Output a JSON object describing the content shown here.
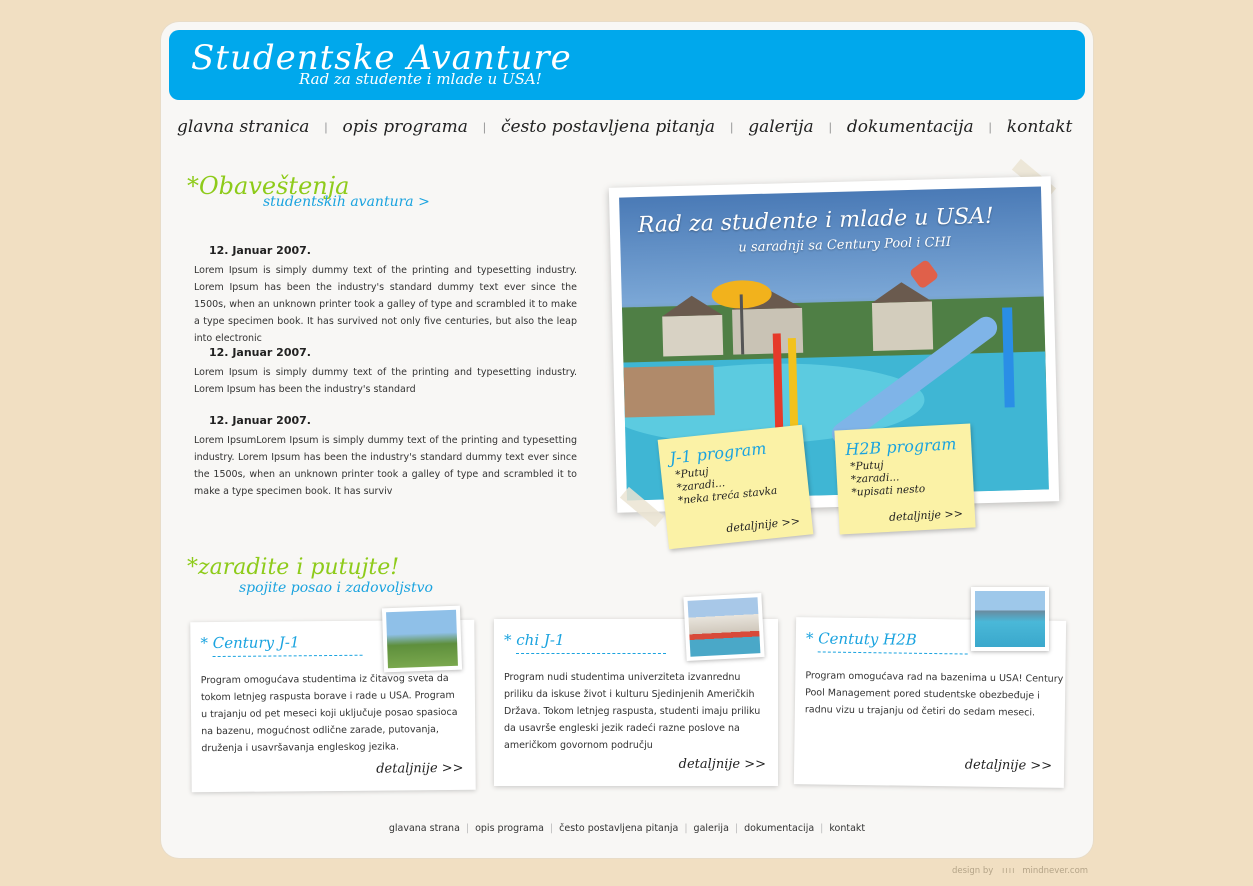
{
  "site": {
    "title": "Studentske Avanture",
    "tagline": "Rad za studente i mlade u USA!"
  },
  "nav": {
    "items": [
      "glavna stranica",
      "opis programa",
      "često postavljena pitanja",
      "galerija",
      "dokumentacija",
      "kontakt"
    ]
  },
  "news_section": {
    "title": "*Obaveštenja",
    "subtitle": "studentskih avantura >",
    "items": [
      {
        "date": "12. Januar 2007.",
        "text": "Lorem Ipsum is simply dummy text of the printing and typesetting industry. Lorem Ipsum has been the industry's standard dummy text ever since the 1500s, when an unknown printer took a galley of type and scrambled it to make a type specimen book. It has survived not only five centuries, but also the leap into electronic"
      },
      {
        "date": "12. Januar 2007.",
        "text": "Lorem Ipsum is simply dummy text of the printing and typesetting industry. Lorem Ipsum has been the industry's standard"
      },
      {
        "date": "12. Januar 2007.",
        "text": "Lorem IpsumLorem Ipsum is simply dummy text of the printing and typesetting industry. Lorem Ipsum has been the industry's standard dummy text ever since the 1500s, when an unknown printer took a galley of type and scrambled it to make a type specimen book. It has surviv"
      }
    ]
  },
  "hero": {
    "headline": "Rad za studente i mlade u USA!",
    "subline": "u saradnji sa Century Pool i CHI",
    "notes": [
      {
        "title": "J-1 program",
        "bullets": [
          "*Putuj",
          "*zaradi...",
          "*neka treća stavka"
        ],
        "more": "detaljnije >>"
      },
      {
        "title": "H2B program",
        "bullets": [
          "*Putuj",
          "*zaradi...",
          "*upisati nesto"
        ],
        "more": "detaljnije >>"
      }
    ]
  },
  "earn_section": {
    "title": "*zaradite i putujte!",
    "subtitle": "spojite posao i zadovoljstvo"
  },
  "cards": [
    {
      "title": "* Century J-1",
      "text": "Program omogućava studentima iz čitavog sveta da tokom letnjeg raspusta borave i rade u USA. Program u trajanju od pet meseci koji uključuje posao spasioca na bazenu, mogućnost odlične zarade, putovanja, druženja i usavršavanja engleskog jezika.",
      "more": "detaljnije >>"
    },
    {
      "title": "* chi J-1",
      "text": "Program nudi studentima univerziteta izvanrednu priliku da iskuse život i kulturu Sjedinjenih Američkih Država. Tokom letnjeg raspusta, studenti imaju priliku da usavrše engleski jezik radeći razne poslove na američkom govornom području",
      "more": "detaljnije >>"
    },
    {
      "title": "* Centuty H2B",
      "text": "Program omogućava rad na bazenima u USA! Century Pool Management pored studentske obezbeđuje i radnu vizu u trajanju od četiri do sedam meseci.",
      "more": "detaljnije >>"
    }
  ],
  "footer": {
    "items": [
      "glavana strana",
      "opis programa",
      "često postavljena pitanja",
      "galerija",
      "dokumentacija",
      "kontakt"
    ],
    "credit_prefix": "design by",
    "credit_bars": "ıııı",
    "credit_name": "mindnever.com"
  },
  "colors": {
    "background": "#f1dfc2",
    "header_blue": "#00a8ec",
    "accent_green": "#8ecb1a",
    "accent_blue": "#1aa3df",
    "note_yellow": "#fbf2a6"
  }
}
